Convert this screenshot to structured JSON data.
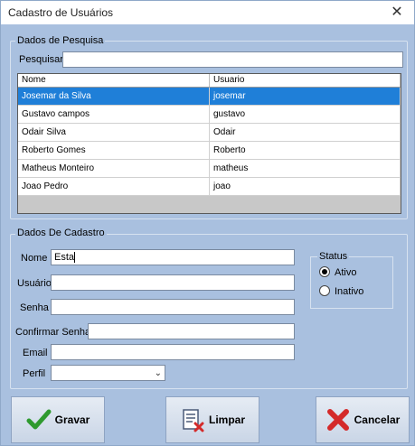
{
  "window": {
    "title": "Cadastro de Usuários",
    "close_label": "✕"
  },
  "search_group": {
    "legend": "Dados de Pesquisa",
    "search_label": "Pesquisar",
    "search_value": ""
  },
  "grid": {
    "columns": [
      "Nome",
      "Usuario"
    ],
    "rows": [
      {
        "nome": "Josemar da Silva",
        "usuario": "josemar",
        "selected": true
      },
      {
        "nome": "Gustavo campos",
        "usuario": "gustavo",
        "selected": false
      },
      {
        "nome": "Odair Silva",
        "usuario": "Odair",
        "selected": false
      },
      {
        "nome": "Roberto Gomes",
        "usuario": "Roberto",
        "selected": false
      },
      {
        "nome": "Matheus Monteiro",
        "usuario": "matheus",
        "selected": false
      },
      {
        "nome": "Joao Pedro",
        "usuario": "joao",
        "selected": false
      }
    ]
  },
  "form_group": {
    "legend": "Dados De Cadastro",
    "nome_label": "Nome",
    "nome_value": "Esta",
    "usuario_label": "Usuário",
    "usuario_value": "",
    "senha_label": "Senha",
    "senha_value": "",
    "confirmar_label": "Confirmar Senha",
    "confirmar_value": "",
    "email_label": "Email",
    "email_value": "",
    "perfil_label": "Perfil",
    "perfil_value": ""
  },
  "status": {
    "legend": "Status",
    "ativo_label": "Ativo",
    "inativo_label": "Inativo",
    "selected": "Ativo"
  },
  "buttons": {
    "gravar": "Gravar",
    "limpar": "Limpar",
    "cancelar": "Cancelar"
  },
  "colors": {
    "background": "#a9c0df",
    "selection": "#1f7fd8",
    "gravar_icon": "#2f9a2f",
    "cancelar_icon": "#d42a2a"
  },
  "icons": {
    "gravar": "checkmark-icon",
    "limpar": "clear-document-icon",
    "cancelar": "red-x-icon",
    "perfil_dropdown": "chevron-down-icon"
  }
}
